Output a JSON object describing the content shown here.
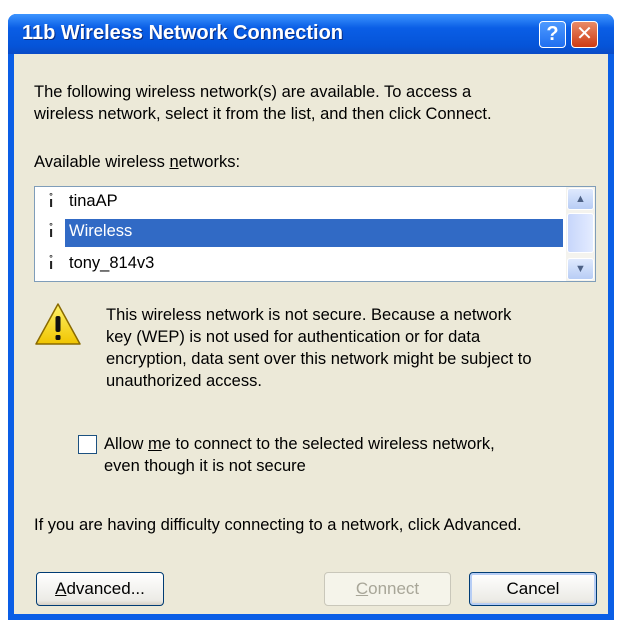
{
  "window": {
    "title": "11b Wireless Network Connection",
    "help_glyph": "?",
    "close_glyph": "✕"
  },
  "intro": {
    "line1": "The following wireless network(s) are available. To access a",
    "line2": "wireless network, select it from the list, and then click Connect."
  },
  "networks_label": {
    "before": "Available wireless ",
    "accel": "n",
    "after": "etworks:"
  },
  "networks": [
    {
      "name": "tinaAP",
      "selected": false
    },
    {
      "name": "Wireless",
      "selected": true
    },
    {
      "name": "tony_814v3",
      "selected": false
    }
  ],
  "warning": {
    "line1": "This wireless network is not secure. Because a network",
    "line2": "key (WEP) is not used for authentication or for data",
    "line3": "encryption, data sent over this network might be subject to",
    "line4": "unauthorized access."
  },
  "allow": {
    "before": "Allow ",
    "accel": "m",
    "after": "e to connect to the selected wireless network,",
    "line2": "even though it is not secure",
    "checked": false
  },
  "help_text": "If you are having difficulty connecting to a network, click Advanced.",
  "buttons": {
    "advanced": {
      "accel": "A",
      "rest": "dvanced..."
    },
    "connect": {
      "accel": "C",
      "rest": "onnect",
      "enabled": false
    },
    "cancel": "Cancel"
  },
  "colors": {
    "titlebar": "#0a5ee6",
    "selection": "#316ac5",
    "face": "#ece9d8"
  }
}
